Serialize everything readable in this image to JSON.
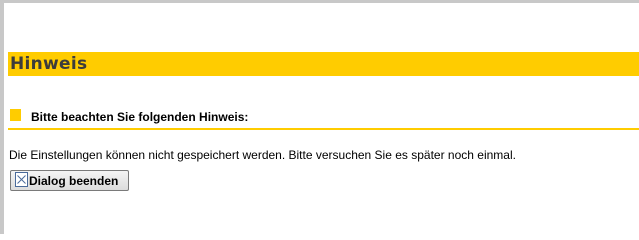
{
  "dialog": {
    "title": "Hinweis",
    "section_label": "Bitte beachten Sie folgenden Hinweis:",
    "message": "Die Einstellungen können nicht gespeichert werden. Bitte versuchen Sie es später noch einmal.",
    "close_button_label": "Dialog beenden",
    "close_button_icon": "broken-image-icon"
  },
  "colors": {
    "accent": "#ffcc00",
    "title_text": "#3c3c3c",
    "frame": "#c8c8c8"
  }
}
